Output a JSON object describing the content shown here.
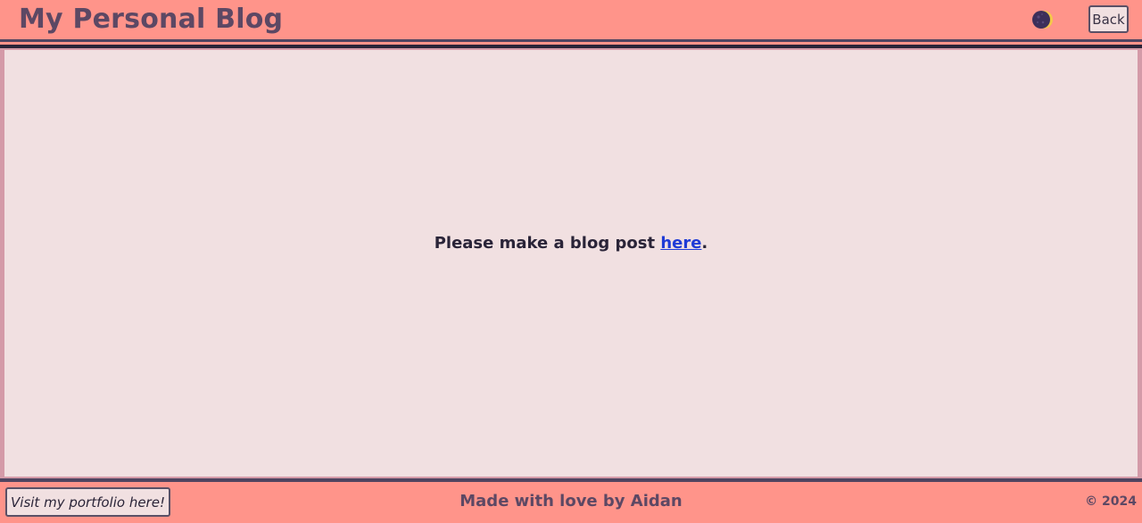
{
  "header": {
    "title": "My Personal Blog",
    "theme_toggle_icon": "moon-icon",
    "back_label": "Back"
  },
  "main": {
    "message_prefix": "Please make a blog post ",
    "link_text": "here",
    "message_suffix": "."
  },
  "footer": {
    "portfolio_label": "Visit my portfolio here!",
    "credit": "Made with love by Aidan",
    "copyright": "© 2024"
  },
  "colors": {
    "header_bg": "#ff948a",
    "page_bg": "#f1e0e1",
    "title_color": "#5c4864",
    "link_color": "#1f3bd6",
    "frame_color": "#d49aa8",
    "border_dark": "#4f4460"
  }
}
